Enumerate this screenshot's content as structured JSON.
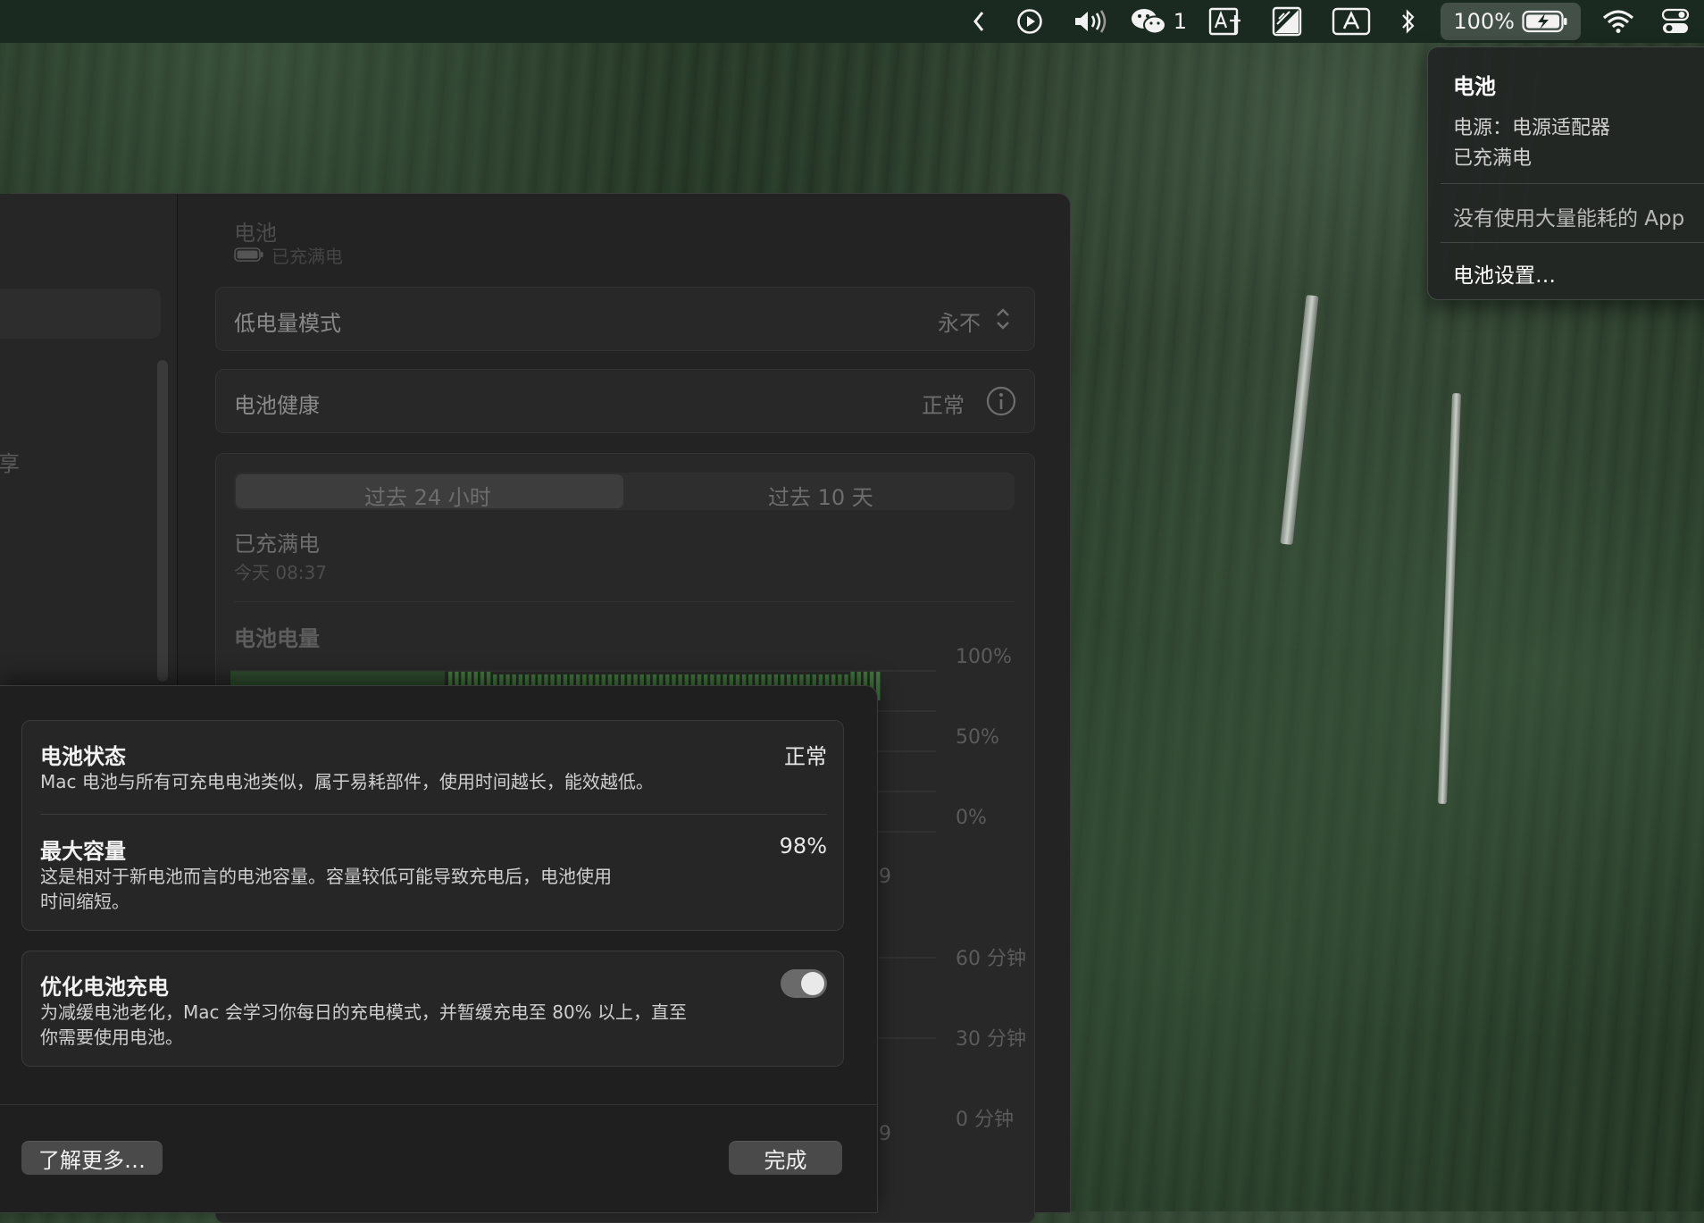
{
  "menubar": {
    "wechat_count": "1",
    "battery_percent": "100%",
    "icons": [
      "chevron-left-icon",
      "play-icon",
      "volume-icon",
      "wechat-icon",
      "text-input-icon",
      "brightness-icon",
      "input-source-icon",
      "bluetooth-icon",
      "battery-icon",
      "wifi-icon",
      "control-center-icon"
    ]
  },
  "dropdown": {
    "title": "电池",
    "power_source": "电源：电源适配器",
    "charge_status": "已充满电",
    "no_apps": "没有使用大量能耗的 App",
    "settings": "电池设置…"
  },
  "window": {
    "sidebar_fragment": "享",
    "header_title": "电池",
    "header_sub": "已充满电",
    "low_power": {
      "label": "低电量模式",
      "value": "永不"
    },
    "health": {
      "label": "电池健康",
      "value": "正常"
    },
    "tabs": [
      "过去 24 小时",
      "过去 10 天"
    ],
    "charged_title": "已充满电",
    "charged_time": "今天 08:37",
    "chart_title": "电池电量",
    "y_labels_level": [
      "100%",
      "50%",
      "0%"
    ],
    "y_labels_usage": [
      "60 分钟",
      "30 分钟",
      "0 分钟"
    ],
    "hidden_tick_1": "9",
    "hidden_tick_2": "9"
  },
  "chart_data": {
    "type": "bar",
    "title": "电池电量",
    "ylim": [
      0,
      100
    ],
    "y_ticks": [
      "100%",
      "50%",
      "0%"
    ],
    "series": [
      {
        "values": [
          97,
          97,
          97,
          97,
          97,
          97,
          97,
          97,
          97,
          97,
          97,
          97,
          97,
          97,
          97,
          97,
          97,
          97,
          97,
          97,
          97,
          97,
          97,
          97,
          97,
          97,
          97,
          97,
          97,
          97,
          97,
          97,
          97,
          97,
          97,
          97,
          97,
          97,
          97,
          97,
          97,
          97,
          97,
          97,
          97,
          97,
          97,
          97,
          97,
          97,
          97,
          97,
          97,
          97,
          97,
          97,
          97,
          97,
          97,
          97,
          97,
          97,
          97,
          97,
          97,
          97,
          97,
          97
        ]
      }
    ],
    "colors": {
      "bar": "#3f7a3a",
      "bar_faded": "#2d4a2c"
    }
  },
  "sheet": {
    "status": {
      "title": "电池状态",
      "value": "正常",
      "desc": "Mac 电池与所有可充电电池类似，属于易耗部件，使用时间越长，能效越低。"
    },
    "capacity": {
      "title": "最大容量",
      "value": "98%",
      "desc_line1": "这是相对于新电池而言的电池容量。容量较低可能导致充电后，电池使用",
      "desc_line2": "时间缩短。"
    },
    "optimize": {
      "title": "优化电池充电",
      "enabled": true,
      "desc_line1": "为减缓电池老化，Mac 会学习你每日的充电模式，并暂缓充电至 80% 以上，直至",
      "desc_line2": "你需要使用电池。"
    },
    "learn_more": "了解更多…",
    "done": "完成"
  }
}
